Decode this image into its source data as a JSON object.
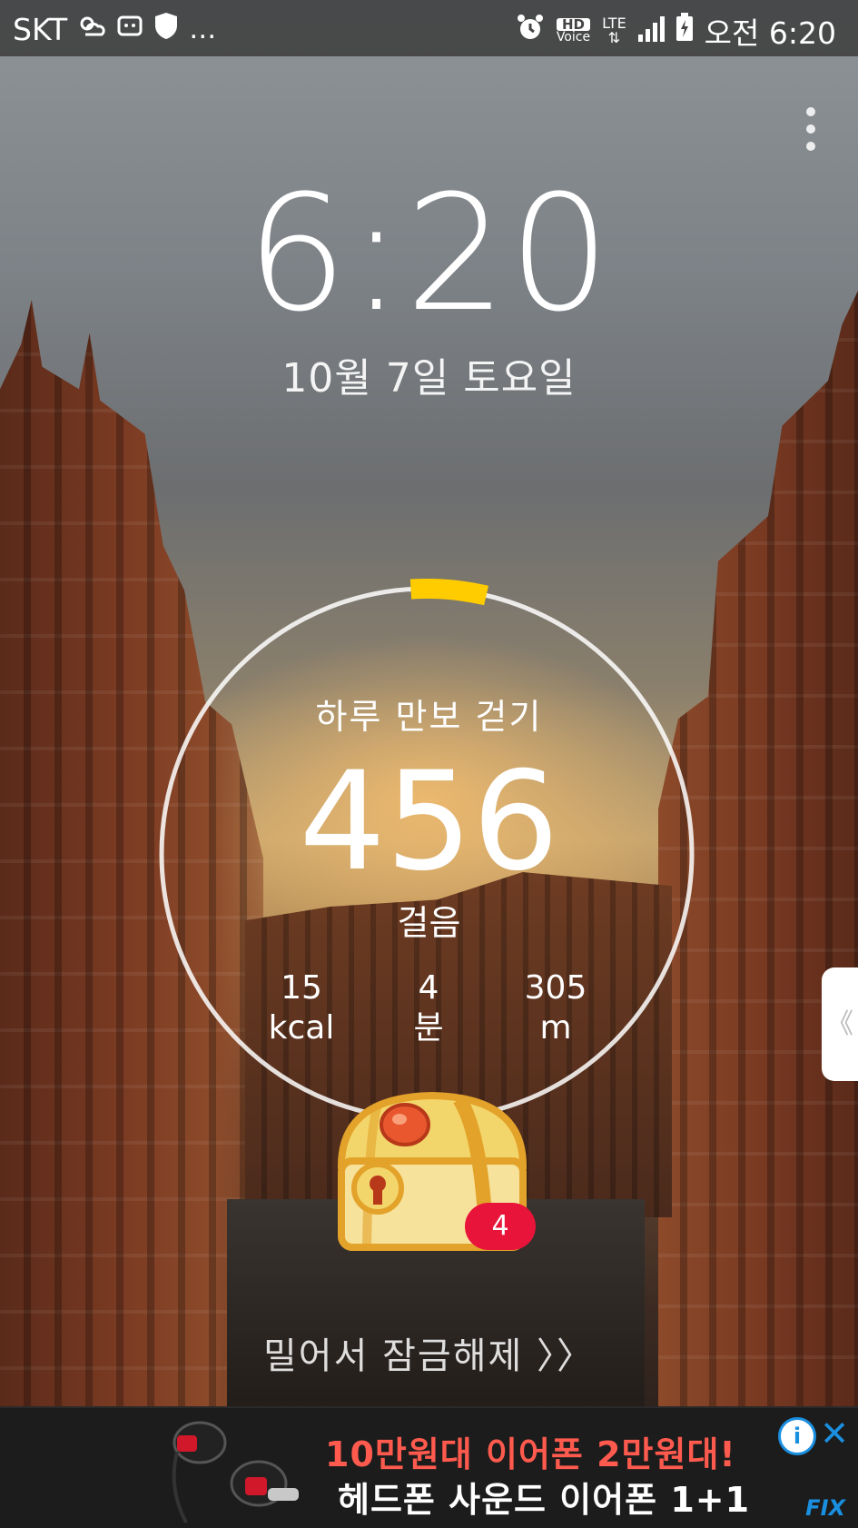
{
  "status_bar": {
    "carrier": "SKT",
    "hd_voice_top": "HD",
    "hd_voice_bottom": "Voice",
    "network": "LTE",
    "time": "오전 6:20"
  },
  "lockscreen": {
    "time": "6:20",
    "date": "10월 7일 토요일",
    "unlock_hint": "밀어서 잠금해제 〉〉"
  },
  "pedometer": {
    "title": "하루 만보 걷기",
    "steps": "456",
    "steps_unit": "걸음",
    "goal_progress": 0.0456,
    "stats": [
      {
        "value": "15",
        "unit": "kcal"
      },
      {
        "value": "4",
        "unit": "분"
      },
      {
        "value": "305",
        "unit": "m"
      }
    ],
    "chest_badge": "4"
  },
  "side_handle": {
    "icon": "《"
  },
  "ad": {
    "line1": "10만원대 이어폰 2만원대!",
    "line2": "헤드폰 사운드 이어폰 1+1",
    "info_icon": "i",
    "close_icon": "✕",
    "logo": "FIX"
  },
  "colors": {
    "progress_yellow": "#FFCC00",
    "badge_red": "#E8143A",
    "ad_red": "#FF5A4E",
    "ad_blue": "#1A8FE0"
  }
}
